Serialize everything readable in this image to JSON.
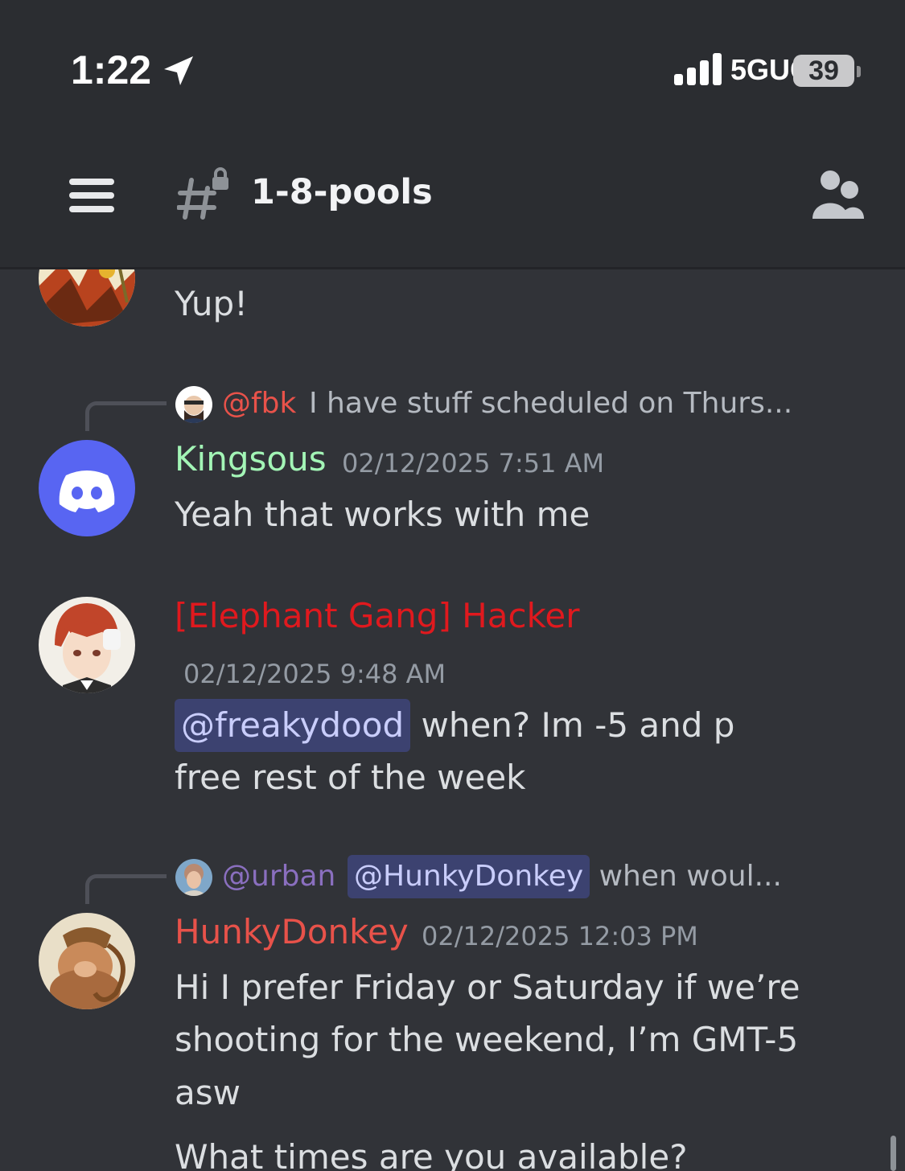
{
  "status_bar": {
    "time": "1:22",
    "network": "5GUC",
    "battery": "39"
  },
  "header": {
    "channel_name": "1-8-pools"
  },
  "messages": [
    {
      "text": "Yup!"
    },
    {
      "reply": {
        "user": "@fbk",
        "text": "I have stuff scheduled on Thurs..."
      },
      "username": "Kingsous",
      "timestamp": "02/12/2025 7:51 AM",
      "lines": [
        "Yeah that works with me"
      ]
    },
    {
      "username": "[Elephant Gang] Hacker",
      "timestamp": "02/12/2025 9:48 AM",
      "mention": "@freakydood",
      "line1_rest": "when? Im -5 and p",
      "line2": "free rest of the week"
    },
    {
      "reply": {
        "user": "@urban",
        "mention": "@HunkyDonkey",
        "text": "when woul..."
      },
      "username": "HunkyDonkey",
      "timestamp": "02/12/2025 12:03 PM",
      "lines": [
        "Hi I prefer Friday or Saturday if we’re",
        "shooting for the weekend, I’m GMT-5",
        "asw",
        "What times are you available?"
      ]
    }
  ],
  "colors": {
    "background": "#313338",
    "header": "#2b2d31",
    "kingsous": "#a3f5b6",
    "hacker": "#e0191e",
    "hunkydonkey": "#e8524a",
    "fbk": "#e8524a",
    "urban": "#8a6fbf",
    "mention_bg": "#3c4270"
  }
}
